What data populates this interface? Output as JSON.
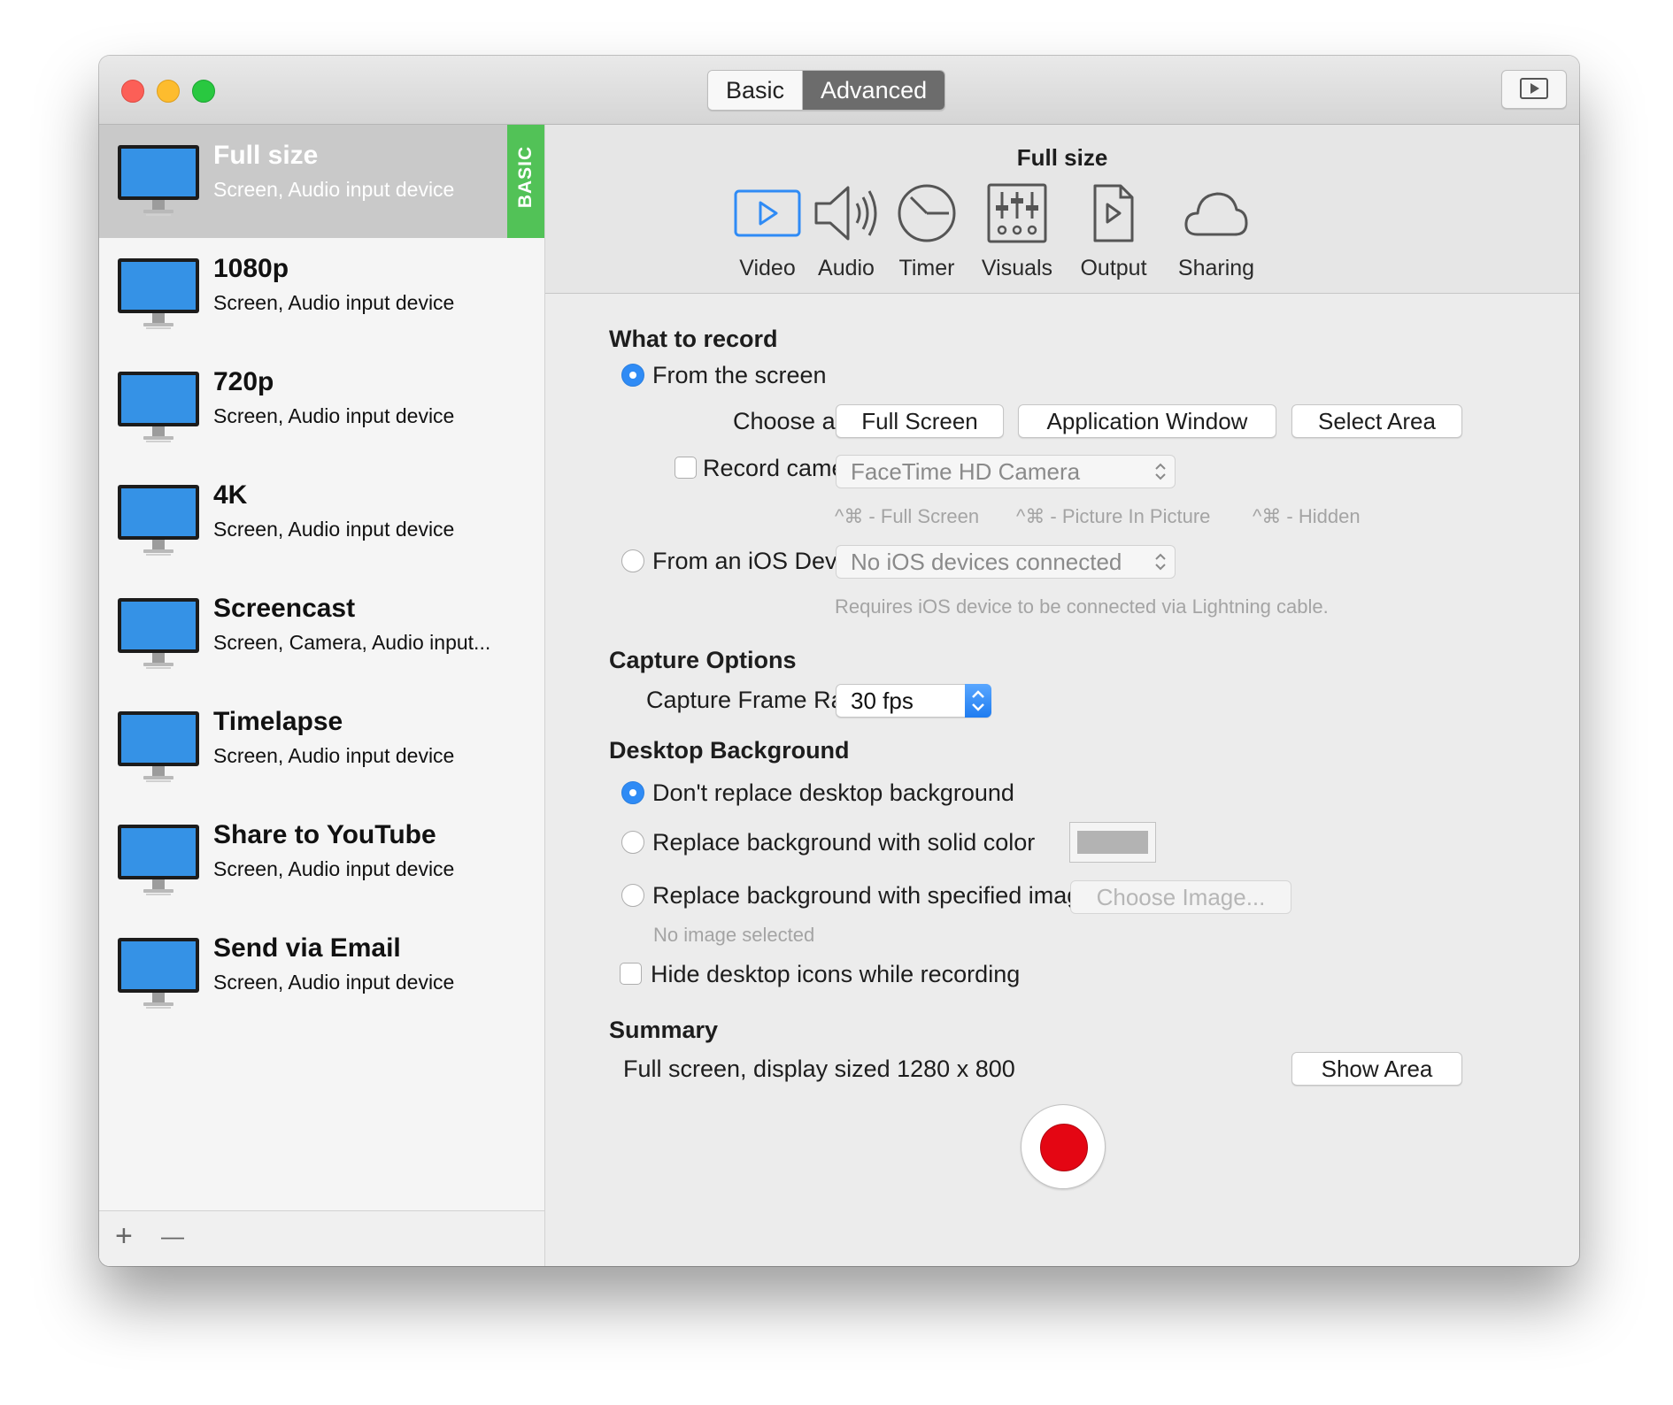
{
  "window": {
    "mode_tabs": {
      "basic": "Basic",
      "advanced": "Advanced",
      "selected": "Advanced"
    },
    "play_icon": "play-rectangle-icon"
  },
  "sidebar": {
    "badge": "BASIC",
    "presets": [
      {
        "name": "Full size",
        "desc": "Screen, Audio input device",
        "selected": true
      },
      {
        "name": "1080p",
        "desc": "Screen, Audio input device"
      },
      {
        "name": "720p",
        "desc": "Screen, Audio input device"
      },
      {
        "name": "4K",
        "desc": "Screen, Audio input device"
      },
      {
        "name": "Screencast",
        "desc": "Screen, Camera, Audio input..."
      },
      {
        "name": "Timelapse",
        "desc": "Screen, Audio input device"
      },
      {
        "name": "Share to YouTube",
        "desc": "Screen, Audio input device"
      },
      {
        "name": "Send via Email",
        "desc": "Screen, Audio input device"
      }
    ],
    "footer": {
      "add": "+",
      "remove": "—"
    }
  },
  "panel": {
    "title": "Full size",
    "tabs": [
      {
        "label": "Video",
        "icon": "video-play-icon",
        "selected": true
      },
      {
        "label": "Audio",
        "icon": "speaker-icon"
      },
      {
        "label": "Timer",
        "icon": "clock-icon"
      },
      {
        "label": "Visuals",
        "icon": "sliders-icon"
      },
      {
        "label": "Output",
        "icon": "document-play-icon"
      },
      {
        "label": "Sharing",
        "icon": "cloud-icon"
      }
    ]
  },
  "what_to_record": {
    "heading": "What to record",
    "from_screen": "From the screen",
    "choose_area_label": "Choose area",
    "area_buttons": [
      "Full Screen",
      "Application Window",
      "Select Area"
    ],
    "record_camera": "Record camera",
    "camera_select": "FaceTime HD Camera",
    "shortcut_hints": [
      "^⌘ - Full Screen",
      "^⌘ - Picture In Picture",
      "^⌘ - Hidden"
    ],
    "from_ios": "From an iOS Device",
    "ios_select": "No iOS devices connected",
    "ios_hint": "Requires iOS device to be connected via Lightning cable."
  },
  "capture_options": {
    "heading": "Capture Options",
    "frame_rate_label": "Capture Frame Rate:",
    "frame_rate_value": "30 fps"
  },
  "desktop_background": {
    "heading": "Desktop Background",
    "options": [
      "Don't replace desktop background",
      "Replace background with solid color",
      "Replace background with specified image"
    ],
    "selected_option": "Don't replace desktop background",
    "solid_color": "#b3b3b3",
    "choose_image": "Choose Image...",
    "no_image": "No image selected",
    "hide_icons": "Hide desktop icons while recording"
  },
  "summary": {
    "heading": "Summary",
    "text": "Full screen, display sized 1280 x 800",
    "show_area": "Show Area"
  },
  "colors": {
    "accent": "#2f8bf5",
    "badge_green": "#52c257",
    "record_red": "#e40613",
    "monitor_blue": "#3592e6"
  }
}
